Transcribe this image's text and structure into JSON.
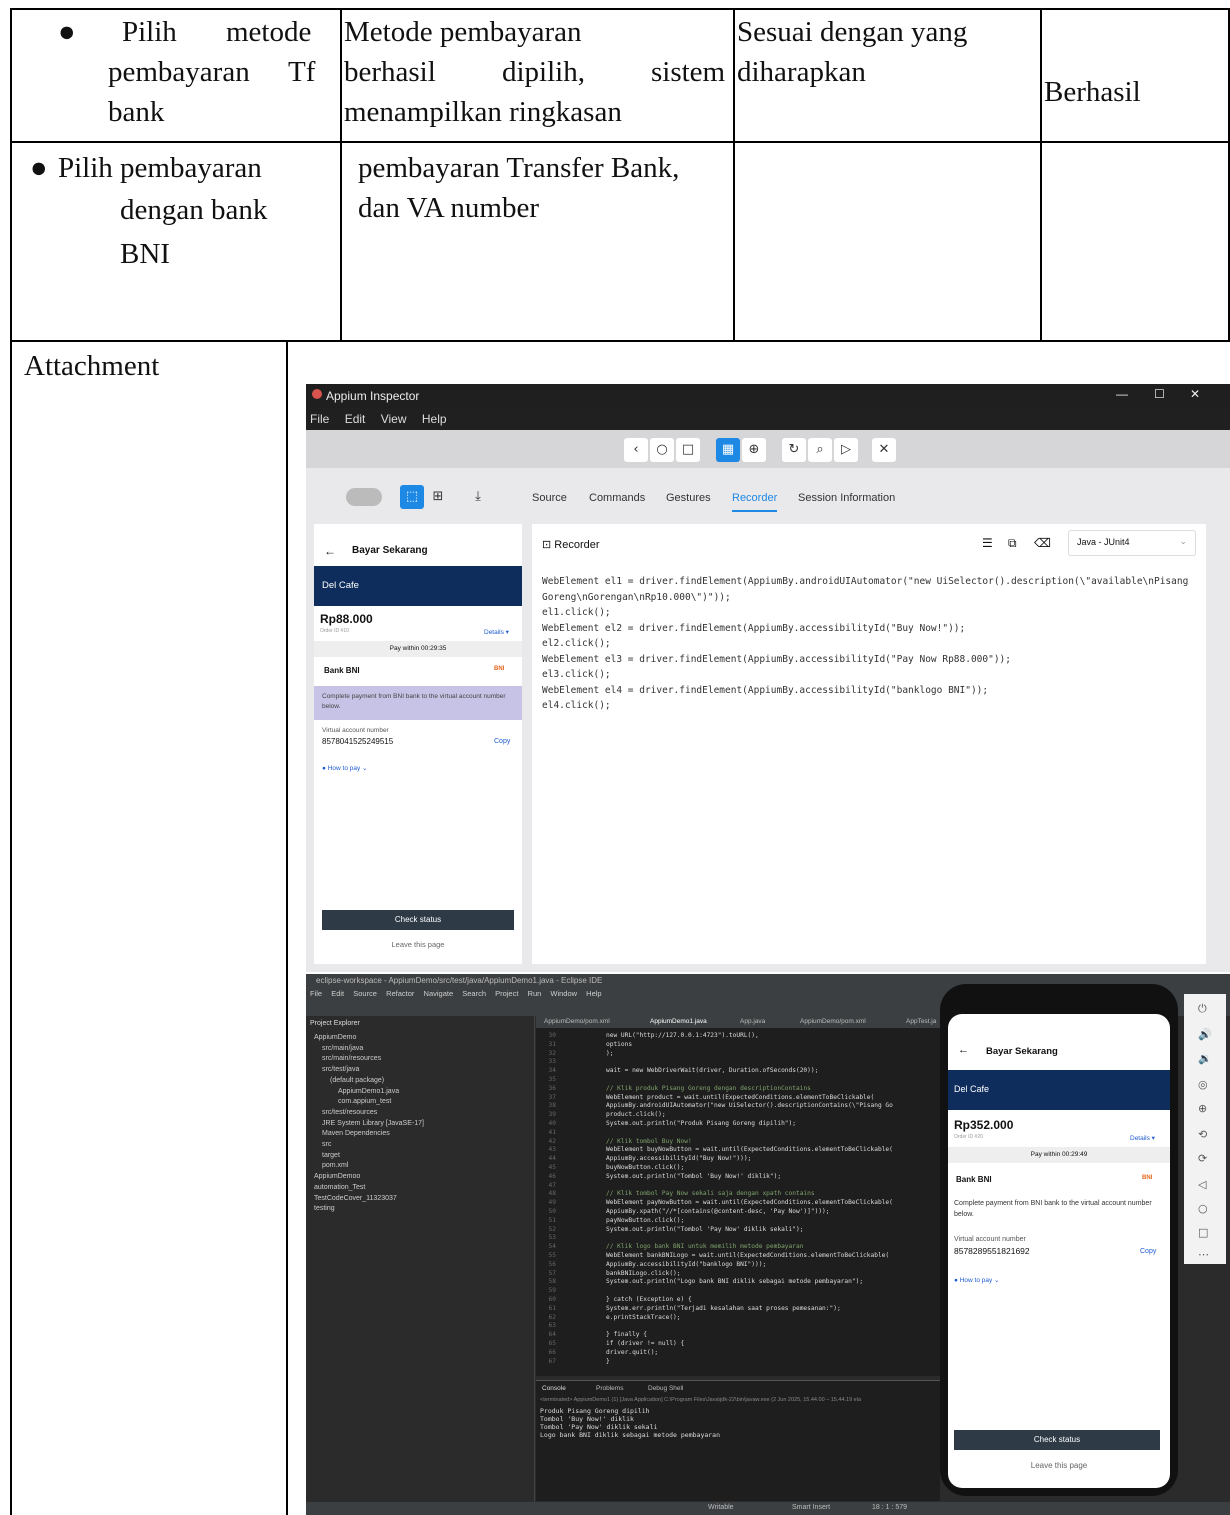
{
  "table": {
    "row1": {
      "col1": [
        "Pilih",
        "metode",
        "pembayaran",
        "Tf",
        "bank"
      ],
      "col2": [
        "Metode pembayaran",
        "berhasil",
        "dipilih,",
        "sistem",
        "menampilkan ringkasan"
      ],
      "col3": [
        "Sesuai dengan yang",
        "diharapkan"
      ],
      "col4": "Berhasil"
    },
    "row2": {
      "col1": [
        "Pilih pembayaran",
        "dengan bank",
        "BNI"
      ],
      "col2": [
        "pembayaran Transfer Bank,",
        "dan VA number"
      ]
    },
    "attachment_label": "Attachment",
    "bullet": "●"
  },
  "inspector": {
    "window_title": "Appium Inspector",
    "menu": [
      "File",
      "Edit",
      "View",
      "Help"
    ],
    "tabs": [
      "Source",
      "Commands",
      "Gestures",
      "Recorder",
      "Session Information"
    ],
    "active_tab": "Recorder",
    "recorder_title": "Recorder",
    "language": "Java - JUnit4",
    "code": [
      "WebElement el1 = driver.findElement(AppiumBy.androidUIAutomator(\"new UiSelector().description(\\\"available\\nPisang",
      "Goreng\\nGorengan\\nRp10.000\\\")\"));",
      "el1.click();",
      "WebElement el2 = driver.findElement(AppiumBy.accessibilityId(\"Buy Now!\"));",
      "el2.click();",
      "WebElement el3 = driver.findElement(AppiumBy.accessibilityId(\"Pay Now Rp88.000\"));",
      "el3.click();",
      "WebElement el4 = driver.findElement(AppiumBy.accessibilityId(\"banklogo BNI\"));",
      "el4.click();"
    ],
    "phone": {
      "header": "Bayar Sekarang",
      "store": "Del Cafe",
      "amount": "Rp88.000",
      "order_id": "Order ID #10",
      "details": "Details ▾",
      "pay_within": "Pay within 00:29:35",
      "bank": "Bank BNI",
      "bank_logo": "BNI",
      "instruction": "Complete payment from BNI bank to the virtual account number below.",
      "va_label": "Virtual account number",
      "va_number": "8578041525249515",
      "copy": "Copy",
      "how_to_pay": "How to pay ⌄",
      "check_status": "Check status",
      "leave": "Leave this page"
    }
  },
  "eclipse": {
    "title": "eclipse-workspace - AppiumDemo/src/test/java/AppiumDemo1.java - Eclipse IDE",
    "menu": [
      "File",
      "Edit",
      "Source",
      "Refactor",
      "Navigate",
      "Search",
      "Project",
      "Run",
      "Window",
      "Help"
    ],
    "explorer_title": "Project Explorer",
    "tree": [
      "AppiumDemo",
      "src/main/java",
      "src/main/resources",
      "src/test/java",
      "(default package)",
      "AppiumDemo1.java",
      "com.appium_test",
      "src/test/resources",
      "JRE System Library [JavaSE-17]",
      "Maven Dependencies",
      "src",
      "target",
      "pom.xml",
      "AppiumDemoo",
      "automation_Test",
      "TestCodeCover_11323037",
      "testing"
    ],
    "editor_tabs": [
      "AppiumDemo/pom.xml",
      "AppiumDemo1.java",
      "App.java",
      "AppiumDemo/pom.xml",
      "AppTest.ja"
    ],
    "line_numbers": [
      "30",
      "31",
      "32",
      "33",
      "34",
      "35",
      "36",
      "37",
      "38",
      "39",
      "40",
      "41",
      "42",
      "43",
      "44",
      "45",
      "46",
      "47",
      "48",
      "49",
      "50",
      "51",
      "52",
      "53",
      "54",
      "55",
      "56",
      "57",
      "58",
      "59",
      "60",
      "61",
      "62",
      "63",
      "64",
      "65",
      "66",
      "67"
    ],
    "code": [
      "    new URL(\"http://127.0.0.1:4723\").toURL(),",
      "    options",
      ");",
      "",
      "wait = new WebDriverWait(driver, Duration.ofSeconds(20));",
      "",
      "// Klik produk Pisang Goreng dengan descriptionContains",
      "WebElement product = wait.until(ExpectedConditions.elementToBeClickable(",
      "    AppiumBy.androidUIAutomator(\"new UiSelector().descriptionContains(\\\"Pisang Go",
      "product.click();",
      "System.out.println(\"Produk Pisang Goreng dipilih\");",
      "",
      "// Klik tombol Buy Now!",
      "WebElement buyNowButton = wait.until(ExpectedConditions.elementToBeClickable(",
      "    AppiumBy.accessibilityId(\"Buy Now!\")));",
      "buyNowButton.click();",
      "System.out.println(\"Tombol 'Buy Now!' diklik\");",
      "",
      "// Klik tombol Pay Now sekali saja dengan xpath contains",
      "WebElement payNowButton = wait.until(ExpectedConditions.elementToBeClickable(",
      "    AppiumBy.xpath(\"//*[contains(@content-desc, 'Pay Now')]\")));",
      "payNowButton.click();",
      "System.out.println(\"Tombol 'Pay Now' diklik sekali\");",
      "",
      "// Klik logo bank BNI untuk memilih metode pembayaran",
      "WebElement bankBNILogo = wait.until(ExpectedConditions.elementToBeClickable(",
      "    AppiumBy.accessibilityId(\"banklogo BNI\")));",
      "bankBNILogo.click();",
      "System.out.println(\"Logo bank BNI diklik sebagai metode pembayaran\");",
      "",
      "} catch (Exception e) {",
      "    System.err.println(\"Terjadi kesalahan saat proses pemesanan:\");",
      "    e.printStackTrace();",
      "",
      "} finally {",
      "    if (driver != null) {",
      "        driver.quit();",
      "    }"
    ],
    "console_tabs": [
      "Console",
      "Problems",
      "Debug Shell"
    ],
    "console_header": "<terminated> AppiumDemo1 (1) [Java Application] C:\\Program Files\\Java\\jdk-22\\bin\\javaw.exe (2 Jun 2025, 15.44.00 – 15.44.19 ela",
    "console_lines": [
      "Produk Pisang Goreng dipilih",
      "Tombol 'Buy Now!' diklik",
      "Tombol 'Pay Now' diklik sekali",
      "Logo bank BNI diklik sebagai metode pembayaran"
    ],
    "status": [
      "Writable",
      "Smart Insert",
      "18 : 1 : 579"
    ],
    "phone": {
      "header": "Bayar Sekarang",
      "store": "Del Cafe",
      "amount": "Rp352.000",
      "order_id": "Order ID #20",
      "details": "Details ▾",
      "pay_within": "Pay within 00:29:49",
      "bank": "Bank BNI",
      "bank_logo": "BNI",
      "instruction": "Complete payment from BNI bank to the virtual account number below.",
      "va_label": "Virtual account number",
      "va_number": "8578289551821692",
      "copy": "Copy",
      "how_to_pay": "How to pay ⌄",
      "check_status": "Check status",
      "leave": "Leave this page"
    }
  }
}
